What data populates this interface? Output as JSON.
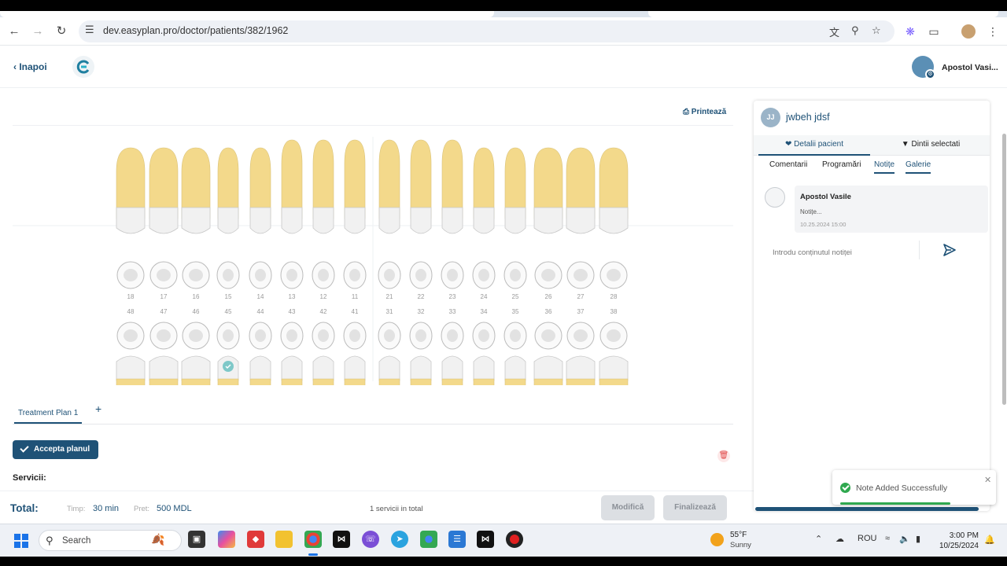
{
  "browser": {
    "url": "dev.easyplan.pro/doctor/patients/382/1962",
    "icons": [
      "back-arrow",
      "forward-arrow",
      "reload",
      "site-settings",
      "translate",
      "zoom",
      "bookmark-star",
      "extension-puzzle",
      "profile-avatar",
      "more-menu"
    ]
  },
  "header": {
    "back_label": "Inapoi",
    "doctor_name": "Apostol Vasi..."
  },
  "chart": {
    "print_label": "Printează",
    "upper_numbers": [
      "18",
      "17",
      "16",
      "15",
      "14",
      "13",
      "12",
      "11",
      "21",
      "22",
      "23",
      "24",
      "25",
      "26",
      "27",
      "28"
    ],
    "lower_numbers": [
      "48",
      "47",
      "46",
      "45",
      "44",
      "43",
      "42",
      "41",
      "31",
      "32",
      "33",
      "34",
      "35",
      "36",
      "37",
      "38"
    ],
    "selected_tooth": "45"
  },
  "plan": {
    "tab_label": "Treatment Plan 1",
    "add_label": "+",
    "accept_label": "Accepta planul",
    "services_label": "Servicii:"
  },
  "footer": {
    "total_label": "Total:",
    "time_label": "Timp:",
    "time_value": "30 min",
    "price_label": "Pret:",
    "price_value": "500 MDL",
    "services_count": "1 servicii in total",
    "modify_label": "Modifică",
    "finalize_label": "Finalizează"
  },
  "panel": {
    "patient_initials": "JJ",
    "patient_name": "jwbeh jdsf",
    "tabs": [
      "Detalii pacient",
      "Dintii selectati"
    ],
    "subtabs": [
      "Comentarii",
      "Programări",
      "Notițe",
      "Galerie"
    ],
    "active_subtab": "Notițe",
    "note": {
      "author": "Apostol Vasile",
      "text": "Notițe...",
      "date": "10.25.2024 15:00"
    },
    "input_placeholder": "Introdu conținutul notiței"
  },
  "toast": {
    "message": "Note Added Successfully"
  },
  "taskbar": {
    "search_label": "Search",
    "weather_temp": "55°F",
    "weather_desc": "Sunny",
    "language": "ROU",
    "time": "3:00 PM",
    "date": "10/25/2024"
  },
  "colors": {
    "primary": "#1f5277",
    "success": "#2fa84f",
    "root": "#f3d98b",
    "danger": "#e04848"
  }
}
